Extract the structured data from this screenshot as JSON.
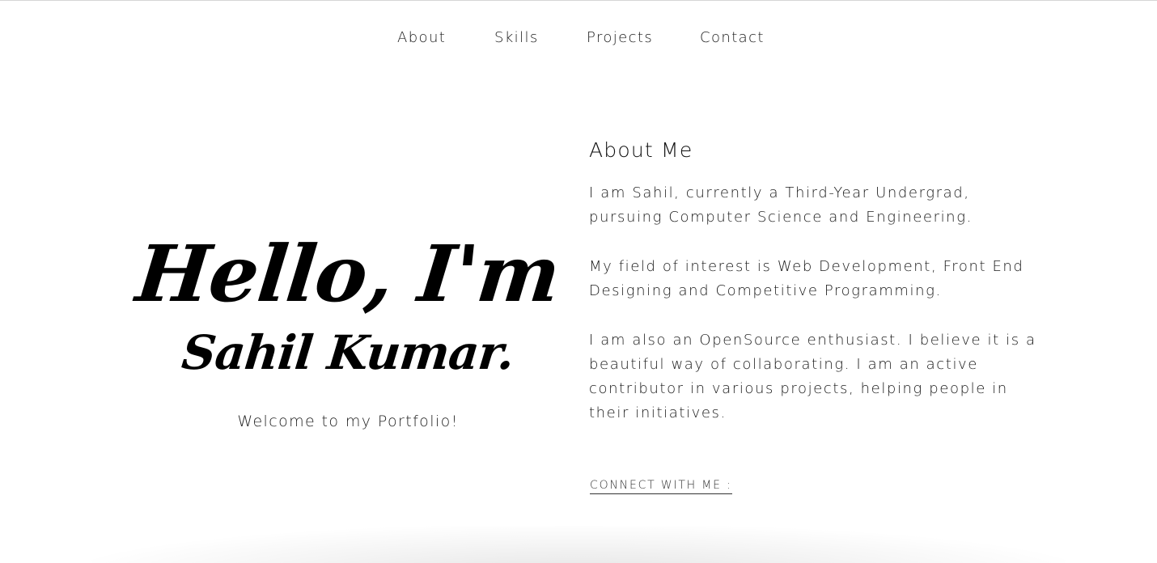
{
  "nav": {
    "items": [
      {
        "label": "About"
      },
      {
        "label": "Skills"
      },
      {
        "label": "Projects"
      },
      {
        "label": "Contact"
      }
    ]
  },
  "hero": {
    "greeting": "Hello, I'm",
    "name": "Sahil Kumar.",
    "welcome": "Welcome to my Portfolio!"
  },
  "about": {
    "heading": "About Me",
    "paragraphs": [
      "I am Sahil, currently a Third-Year Undergrad, pursuing Computer Science and Engineering.",
      "My field of interest is Web Development, Front End Designing and Competitive Programming.",
      "I am also an OpenSource enthusiast. I believe it is a beautiful way of collaborating. I am an active contributor in various projects, helping people in their initiatives."
    ],
    "connect_label": "CONNECT WITH ME :"
  },
  "colors": {
    "background": "#ffffff",
    "text": "#111111",
    "rule": "#d6d6d6"
  }
}
